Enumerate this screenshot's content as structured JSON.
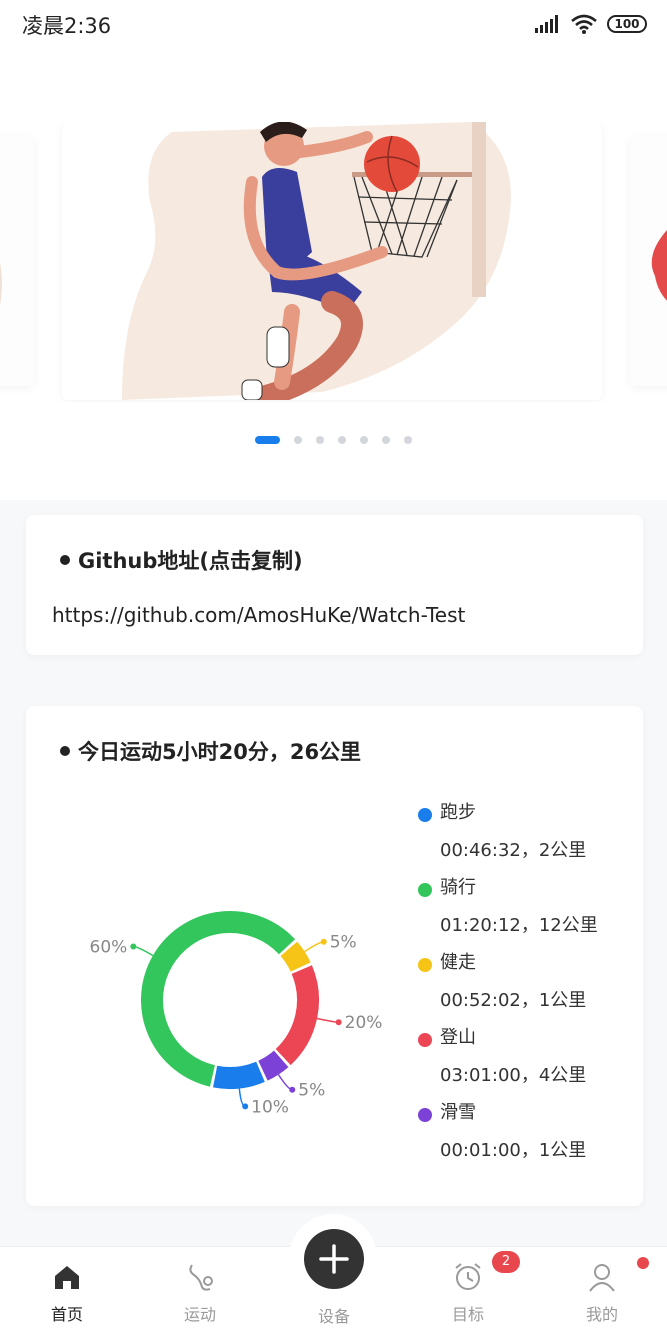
{
  "status_bar": {
    "time": "凌晨2:36",
    "battery": "100"
  },
  "carousel": {
    "slide_count": 7,
    "active_index": 0
  },
  "github_card": {
    "title": "Github地址(点击复制)",
    "url": "https://github.com/AmosHuKe/Watch-Test"
  },
  "sport_card": {
    "title": "今日运动5小时20分，26公里",
    "legend": [
      {
        "name": "跑步",
        "detail": "00:46:32，2公里",
        "color": "#1a7dec"
      },
      {
        "name": "骑行",
        "detail": "01:20:12，12公里",
        "color": "#33c65c"
      },
      {
        "name": "健走",
        "detail": "00:52:02，1公里",
        "color": "#f6c417"
      },
      {
        "name": "登山",
        "detail": "03:01:00，4公里",
        "color": "#ec4655"
      },
      {
        "name": "滑雪",
        "detail": "00:01:00，1公里",
        "color": "#7c41d6"
      }
    ]
  },
  "chart_data": {
    "type": "pie",
    "donut": true,
    "slices": [
      {
        "name": "骑行",
        "value": 60,
        "label": "60%",
        "color": "#33c65c"
      },
      {
        "name": "健走",
        "value": 5,
        "label": "5%",
        "color": "#f6c417"
      },
      {
        "name": "登山",
        "value": 20,
        "label": "20%",
        "color": "#ec4655"
      },
      {
        "name": "滑雪",
        "value": 5,
        "label": "5%",
        "color": "#7c41d6"
      },
      {
        "name": "跑步",
        "value": 10,
        "label": "10%",
        "color": "#1a7dec"
      }
    ]
  },
  "tabbar": {
    "items": [
      {
        "label": "首页",
        "icon": "home-icon",
        "active": true
      },
      {
        "label": "运动",
        "icon": "run-icon",
        "active": false
      },
      {
        "label": "设备",
        "icon": "add-icon",
        "active": false
      },
      {
        "label": "目标",
        "icon": "alarm-icon",
        "active": false
      },
      {
        "label": "我的",
        "icon": "user-icon",
        "active": false
      }
    ],
    "goal_badge": "2"
  }
}
